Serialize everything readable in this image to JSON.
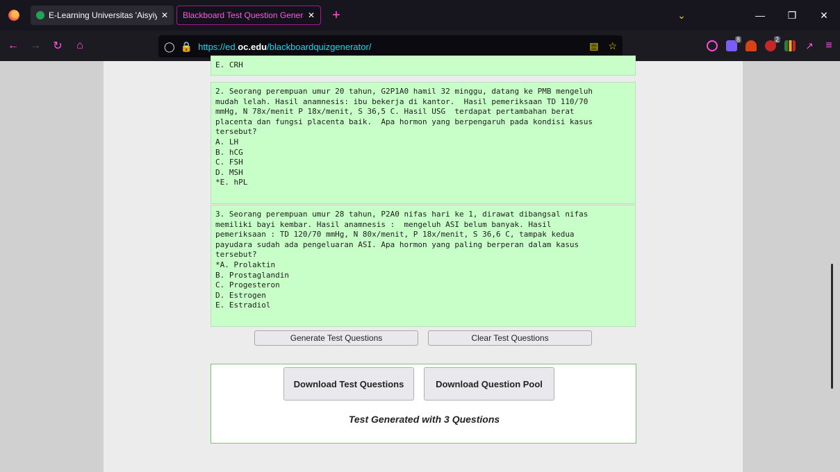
{
  "browser": {
    "tabs": [
      {
        "title": "E-Learning Universitas 'Aisyiyah",
        "close": "✕"
      },
      {
        "title": "Blackboard Test Question Generator",
        "close": "✕"
      }
    ],
    "new_tab": "+",
    "url_prefix": "https://ed.",
    "url_domain": "oc.edu",
    "url_path": "/blackboardquizgenerator/",
    "ext_badges": [
      "8",
      "2"
    ],
    "accent_color": "#ff56e0"
  },
  "questions": [
    "E. CRH",
    "2. Seorang perempuan umur 20 tahun, G2P1A0 hamil 32 minggu, datang ke PMB mengeluh\nmudah lelah. Hasil anamnesis: ibu bekerja di kantor.  Hasil pemeriksaan TD 110/70\nmmHg, N 78x/menit P 18x/menit, S 36,5 C. Hasil USG  terdapat pertambahan berat\nplacenta dan fungsi placenta baik.  Apa hormon yang berpengaruh pada kondisi kasus\ntersebut?\nA. LH\nB. hCG\nC. FSH\nD. MSH\n*E. hPL",
    "3. Seorang perempuan umur 28 tahun, P2A0 nifas hari ke 1, dirawat dibangsal nifas\nmemiliki bayi kembar. Hasil anamnesis :  mengeluh ASI belum banyak. Hasil\npemeriksaan : TD 120/70 mmHg, N 80x/menit, P 18x/menit, S 36,6 C, tampak kedua\npayudara sudah ada pengeluaran ASI. Apa hormon yang paling berperan dalam kasus\ntersebut?\n*A. Prolaktin\nB. Prostaglandin\nC. Progesteron\nD. Estrogen\nE. Estradiol"
  ],
  "buttons": {
    "generate": "Generate Test Questions",
    "clear": "Clear Test Questions",
    "download_test": "Download Test Questions",
    "download_pool": "Download Question Pool"
  },
  "status": "Test Generated with 3 Questions",
  "colors": {
    "question_bg": "#c8ffc8",
    "download_border": "#79c179"
  }
}
